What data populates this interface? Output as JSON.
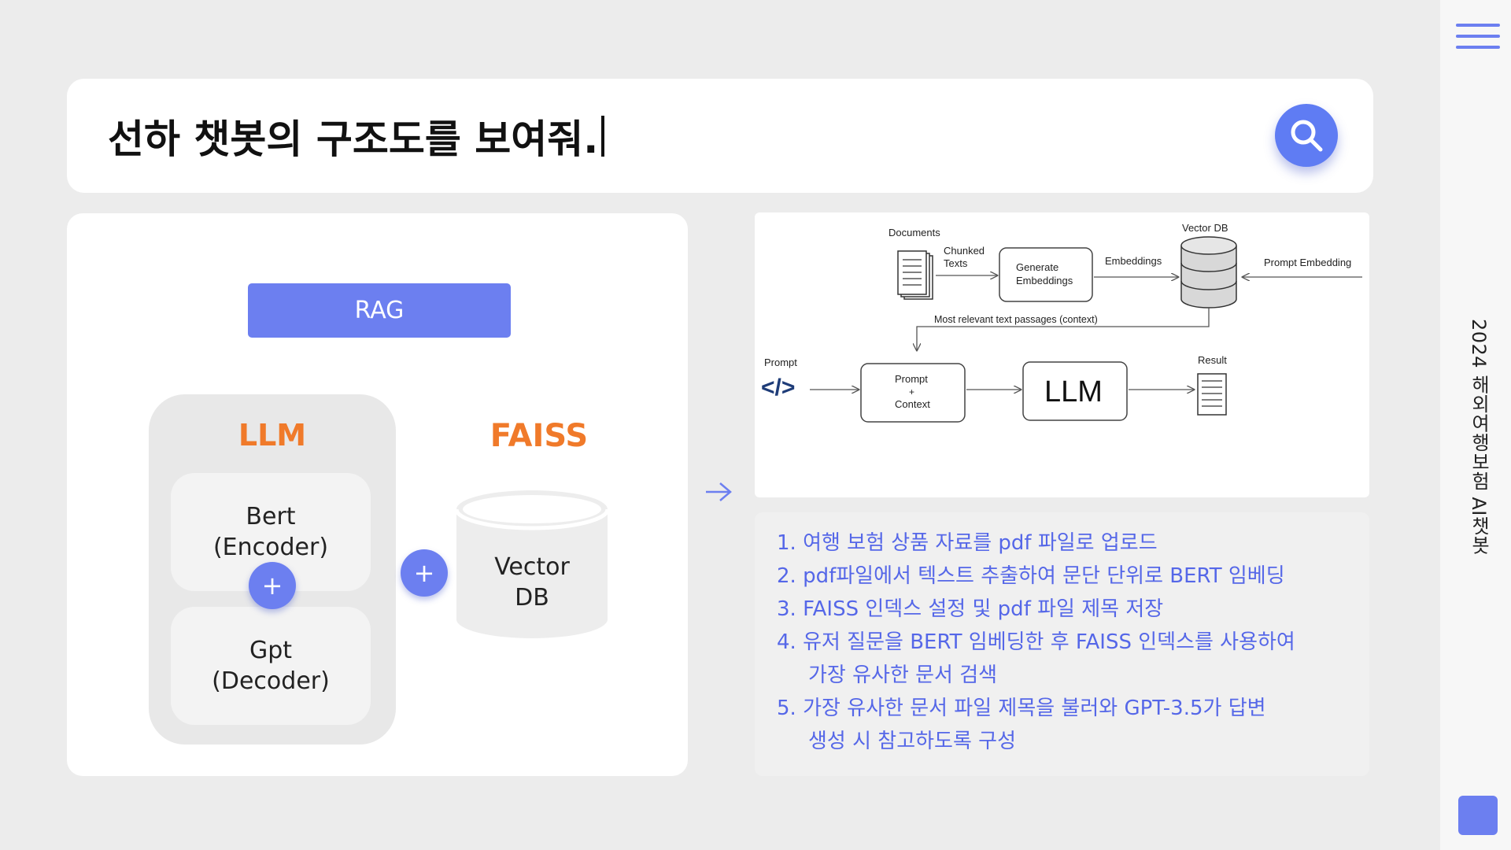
{
  "search": {
    "query": "선하 챗봇의 구조도를 보여줘."
  },
  "sidebar": {
    "vertical_title": "2024 해외여행보험 AI챗봇"
  },
  "architecture": {
    "rag_label": "RAG",
    "llm_title": "LLM",
    "encoder_name": "Bert",
    "encoder_role": "(Encoder)",
    "decoder_name": "Gpt",
    "decoder_role": "(Decoder)",
    "plus_symbol": "+",
    "faiss_title": "FAISS",
    "vector_line1": "Vector",
    "vector_line2": "DB"
  },
  "rag_diagram": {
    "documents": "Documents",
    "chunked_line1": "Chunked",
    "chunked_line2": "Texts",
    "generate_line1": "Generate",
    "generate_line2": "Embeddings",
    "embeddings": "Embeddings",
    "vector_db": "Vector DB",
    "prompt_embedding": "Prompt Embedding",
    "context_note": "Most relevant text passages (context)",
    "prompt": "Prompt",
    "prompt_box_line1": "Prompt",
    "prompt_box_line2": "+",
    "prompt_box_line3": "Context",
    "llm": "LLM",
    "result": "Result",
    "code_icon_text": "</>"
  },
  "steps": [
    "1. 여행 보험 상품 자료를 pdf 파일로 업로드",
    "2. pdf파일에서 텍스트 추출하여 문단 단위로 BERT 임베딩",
    "3. FAISS 인덱스 설정 및 pdf 파일 제목 저장",
    "4. 유저 질문을 BERT 임베딩한 후 FAISS 인덱스를 사용하여",
    "가장 유사한 문서 검색",
    "5. 가장 유사한 문서 파일 제목을 불러와 GPT-3.5가 답변",
    "생성 시 참고하도록 구성"
  ],
  "colors": {
    "accent": "#6c7ff0",
    "orange": "#f07a2a",
    "step_text": "#5567e8"
  },
  "icons": [
    "search-icon",
    "hamburger-menu-icon",
    "arrow-right-icon",
    "plus-icon",
    "database-icon",
    "document-icon",
    "code-icon"
  ]
}
